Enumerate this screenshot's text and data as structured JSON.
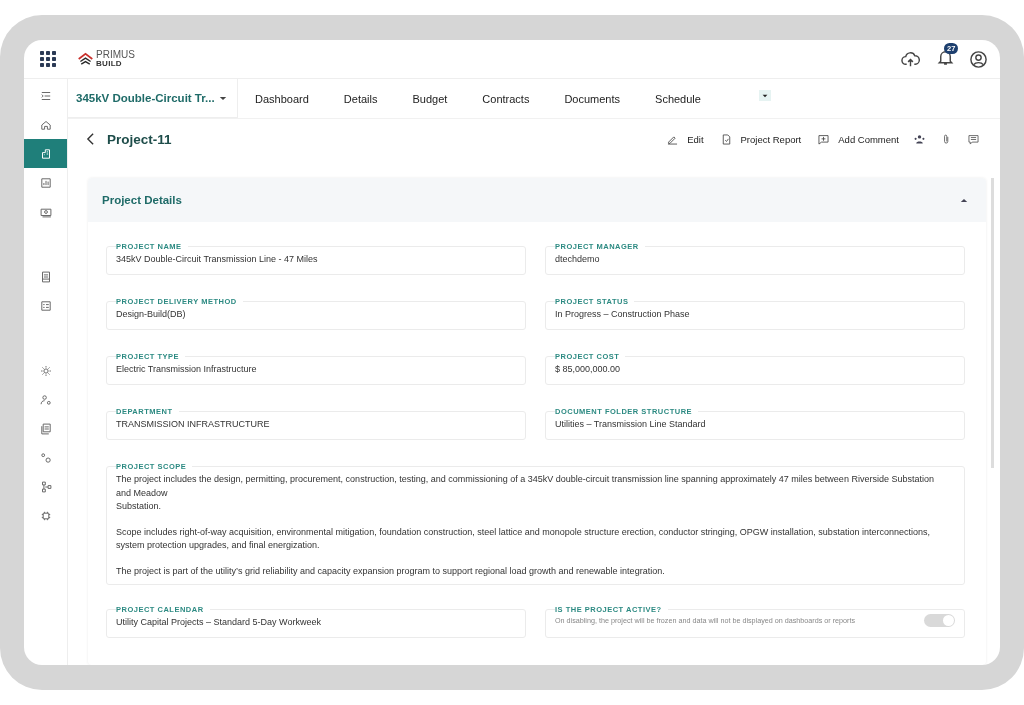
{
  "app": {
    "logo_name": "PRIMUS",
    "logo_sub": "BUILD"
  },
  "notifications": {
    "count": "27"
  },
  "sidebar": {
    "groups": [
      [
        {
          "selected": false
        },
        {
          "selected": false
        },
        {
          "selected": true
        },
        {
          "selected": false
        },
        {
          "selected": false
        }
      ],
      [
        {
          "selected": false
        },
        {
          "selected": false
        }
      ],
      [
        {
          "selected": false
        },
        {
          "selected": false
        },
        {
          "selected": false
        },
        {
          "selected": false
        },
        {
          "selected": false
        },
        {
          "selected": false
        }
      ]
    ]
  },
  "project_selector": {
    "value": "345kV Double-Circuit Tr..."
  },
  "tabs": [
    "Dashboard",
    "Details",
    "Budget",
    "Contracts",
    "Documents",
    "Schedule"
  ],
  "page": {
    "title": "Project-11",
    "actions": [
      "Edit",
      "Project Report",
      "Add Comment"
    ]
  },
  "section": {
    "title": "Project Details",
    "expanded": true
  },
  "fields": [
    {
      "label": "PROJECT NAME",
      "value": "345kV Double-Circuit Transmission Line - 47 Miles"
    },
    {
      "label": "PROJECT MANAGER",
      "value": "dtechdemo"
    },
    {
      "label": "PROJECT DELIVERY METHOD",
      "value": "Design-Build(DB)"
    },
    {
      "label": "PROJECT STATUS",
      "value": "In Progress – Construction Phase"
    },
    {
      "label": "PROJECT TYPE",
      "value": "Electric Transmission Infrastructure"
    },
    {
      "label": "PROJECT COST",
      "value": "$ 85,000,000.00"
    },
    {
      "label": "DEPARTMENT",
      "value": "TRANSMISSION INFRASTRUCTURE"
    },
    {
      "label": "DOCUMENT FOLDER STRUCTURE",
      "value": "Utilities – Transmission Line Standard"
    }
  ],
  "scope": {
    "label": "PROJECT SCOPE",
    "paragraphs": [
      "The project includes the design, permitting, procurement, construction, testing, and commissioning of a 345kV double-circuit transmission line spanning approximately 47 miles between Riverside Substation and Meadow\nSubstation.",
      "Scope includes right-of-way acquisition, environmental mitigation, foundation construction, steel lattice and monopole structure erection, conductor stringing, OPGW installation, substation interconnections, system protection upgrades, and final energization.",
      "The project is part of the utility’s grid reliability and capacity expansion program to support regional load growth and renewable integration."
    ]
  },
  "calendar": {
    "label": "PROJECT CALENDAR",
    "value": "Utility Capital Projects – Standard 5-Day Workweek"
  },
  "active": {
    "label": "IS THE PROJECT ACTIVE?",
    "hint": "On disabling, the project will be frozen and data will not be displayed on dashboards or reports",
    "on": true,
    "disabled": true
  }
}
